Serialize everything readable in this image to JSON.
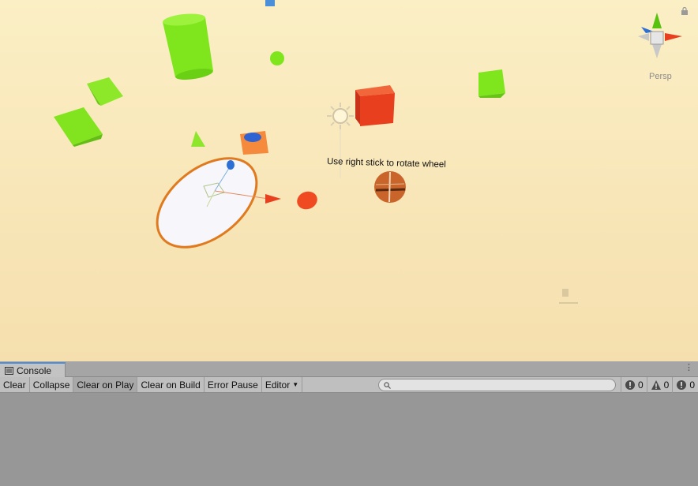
{
  "scene": {
    "overlay_text": "Use right stick to rotate wheel",
    "projection_label": "Persp",
    "colors": {
      "cube_red": "#e8401e",
      "green": "#7fe61e",
      "orange_block": "#f5893c",
      "ball": "#c9652a"
    },
    "icons": [
      "scene-gizmo-icon",
      "sun-light-icon",
      "lock-icon",
      "wheel-gizmo"
    ]
  },
  "console": {
    "tab_label": "Console",
    "toolbar": {
      "clear": "Clear",
      "collapse": "Collapse",
      "clear_on_play": "Clear on Play",
      "clear_on_build": "Clear on Build",
      "error_pause": "Error Pause",
      "editor": "Editor"
    },
    "search": {
      "placeholder": ""
    },
    "counts": {
      "errors": "0",
      "warnings": "0",
      "messages": "0"
    }
  }
}
